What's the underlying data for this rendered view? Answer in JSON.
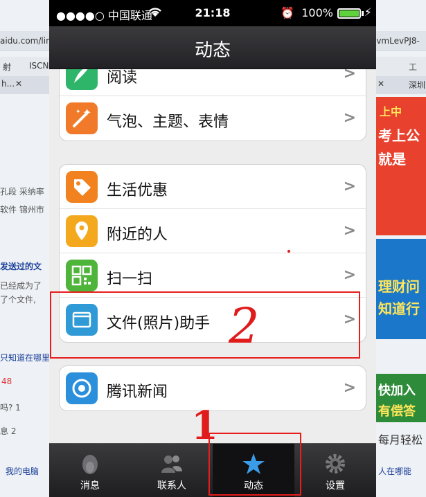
{
  "background": {
    "url_left": "aidu.com/lin",
    "url_right": "lvmLevPJ8-",
    "bookmark_1": "射",
    "bookmark_2": "ISCN",
    "bookmark_right": "工",
    "tab_left": "h...",
    "tab_right": "深圳",
    "left_lines": [
      "孔段 采纳率",
      "软件 锦州市",
      "发送过的文",
      "已经成为了",
      "了个文件,",
      "只知道在哪里",
      "48",
      "吗? 1",
      "息 2",
      "我的电脑"
    ],
    "right_lines": [
      "上中",
      "考上公",
      "就是",
      "理财问",
      "知道行",
      "快加入",
      "有偿答",
      "每月轻松",
      "人在哪能"
    ]
  },
  "statusbar": {
    "carrier": "●●●●○ 中国联通",
    "time": "21:18",
    "battery": "100%"
  },
  "navbar": {
    "title": "动态"
  },
  "groups": [
    {
      "rows": [
        {
          "label": "阅读",
          "icon": "feather-icon",
          "color": "#2fb56a"
        },
        {
          "label": "气泡、主题、表情",
          "icon": "magic-wand-icon",
          "color": "#f07a2a"
        }
      ]
    },
    {
      "rows": [
        {
          "label": "生活优惠",
          "icon": "tag-icon",
          "color": "#f2821f"
        },
        {
          "label": "附近的人",
          "icon": "location-pin-icon",
          "color": "#f3a81e"
        },
        {
          "label": "扫一扫",
          "icon": "qr-code-icon",
          "color": "#4fb43a"
        },
        {
          "label": "文件(照片)助手",
          "icon": "folder-icon",
          "color": "#2f9ad6"
        }
      ]
    },
    {
      "rows": [
        {
          "label": "腾讯新闻",
          "icon": "news-icon",
          "color": "#2b8fdc"
        }
      ]
    }
  ],
  "tabbar": {
    "items": [
      {
        "label": "消息",
        "icon": "penguin-icon"
      },
      {
        "label": "联系人",
        "icon": "contacts-icon"
      },
      {
        "label": "动态",
        "icon": "star-icon",
        "active": true
      },
      {
        "label": "设置",
        "icon": "gear-icon"
      }
    ]
  },
  "annotations": {
    "label_1": "1",
    "label_2": "2"
  }
}
